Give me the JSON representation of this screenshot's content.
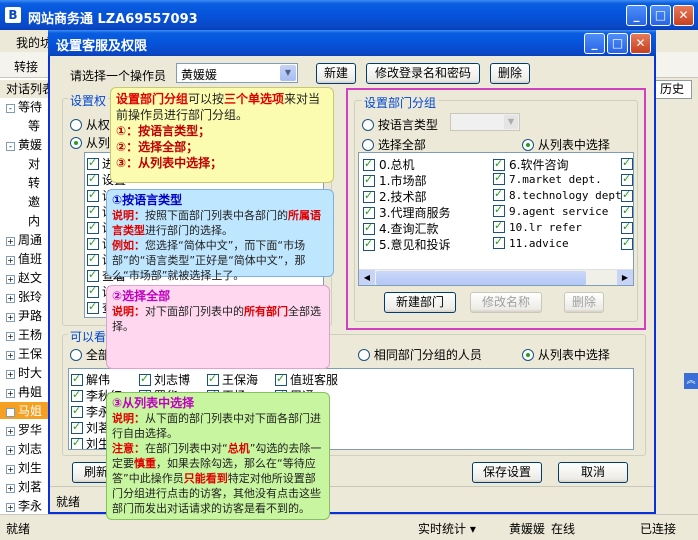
{
  "main_window": {
    "title": "网站商务通 LZA69557093",
    "menu_first": "我的坊",
    "toolbar_first": "转接",
    "left_tab": "对话列表",
    "history_tab": "历史",
    "tree_items": [
      {
        "label": "等待",
        "expanded": "-"
      },
      {
        "label": "等",
        "expanded": ""
      },
      {
        "label": "黄媛",
        "expanded": "-"
      },
      {
        "label": "对",
        "expanded": ""
      },
      {
        "label": "转",
        "expanded": ""
      },
      {
        "label": "邀",
        "expanded": ""
      },
      {
        "label": "内",
        "expanded": ""
      },
      {
        "label": "周通",
        "expanded": "+"
      },
      {
        "label": "值班",
        "expanded": "+"
      },
      {
        "label": "赵文",
        "expanded": "+"
      },
      {
        "label": "张玲",
        "expanded": "+"
      },
      {
        "label": "尹路",
        "expanded": "+"
      },
      {
        "label": "王杨",
        "expanded": "+"
      },
      {
        "label": "王保",
        "expanded": "+"
      },
      {
        "label": "时大",
        "expanded": "+"
      },
      {
        "label": "冉姐",
        "expanded": "+"
      },
      {
        "label": "马姐",
        "expanded": "+"
      },
      {
        "label": "罗华",
        "expanded": "+"
      },
      {
        "label": "刘志",
        "expanded": "+"
      },
      {
        "label": "刘生",
        "expanded": "+"
      },
      {
        "label": "刘茗",
        "expanded": "+"
      },
      {
        "label": "李永",
        "expanded": "+"
      }
    ],
    "status_left": "就绪",
    "status_stats": "实时统计 ▾",
    "status_user": "黄媛媛",
    "status_online": "在线",
    "status_conn": "已连接"
  },
  "dialog": {
    "title": "设置客服及权限",
    "operator_label": "请选择一个操作员",
    "operator_value": "黄媛媛",
    "new_btn": "新建",
    "modify_btn": "修改登录名和密码",
    "delete_btn": "删除",
    "perm_group": "设置权",
    "perm_radio1": "从权",
    "perm_radio2": "从列",
    "perm_items": [
      "进行",
      "设置",
      "设置",
      "设置",
      "设置",
      "设置",
      "设置",
      "查看",
      "设置",
      "查看"
    ],
    "perm_items_right": [
      "",
      "",
      "",
      "",
      "",
      "",
      "",
      "",
      "",
      "",
      "",
      ""
    ],
    "visible_group": "可以看",
    "visible_all": "全部",
    "visible_same": "相同部门分组的人员",
    "visible_list": "从列表中选择",
    "visible_names": [
      [
        "解伟",
        "刘志博",
        "王保海",
        "值班客服"
      ],
      [
        "李秋红",
        "罗华",
        "王杨",
        "周通"
      ],
      [
        "李永",
        "",
        "",
        ""
      ],
      [
        "刘茗",
        "",
        "",
        ""
      ],
      [
        "刘生",
        "",
        "",
        ""
      ]
    ],
    "refresh_btn": "刷新",
    "save_btn": "保存设置",
    "cancel_btn": "取消",
    "status": "就绪",
    "dept": {
      "title": "设置部门分组",
      "radio_lang": "按语言类型",
      "radio_all": "选择全部",
      "radio_list": "从列表中选择",
      "col1": [
        "0.总机",
        "1.市场部",
        "2.技术部",
        "3.代理商服务",
        "4.查询汇款",
        "5.意见和投诉"
      ],
      "col2": [
        "6.软件咨询",
        "7.market dept.",
        "8.technology dept.",
        "9.agent service",
        "10.lr refer",
        "11.advice"
      ],
      "new_btn": "新建部门",
      "rename_btn": "修改名称",
      "delete_btn": "删除"
    }
  },
  "tips": {
    "t1": {
      "a": "设置部门分组",
      "b": "可以按",
      "c": "三个单选项",
      "d": "来对当前操作员进行部门分组。",
      "l1": "①：按语言类型；",
      "l2": "②：选择全部；",
      "l3": "③：从列表中选择；"
    },
    "t2": {
      "h": "①按语言类型",
      "k1": "说明：",
      "p1": "按照下面部门列表中各部门的",
      "r1": "所属语言类型",
      "p2": "进行部门的选择。",
      "k2": "例如：",
      "p3": "您选择“简体中文”，而下面“市场部”的“语言类型”正好是“简体中文”，那么“市场部”就被选择上了。"
    },
    "t3": {
      "h": "②选择全部",
      "k1": "说明：",
      "p1": "对下面部门列表中的",
      "r1": "所有部门",
      "p2": "全部选择。"
    },
    "t4": {
      "h": "③从列表中选择",
      "k1": "说明：",
      "p1": "从下面的部门列表中对下面各部门进行自由选择。",
      "k2": "注意：",
      "p2": "在部门列表中对“",
      "r1": "总机",
      "p3": "”勾选的去除一定要",
      "r2": "慎重",
      "p4": "，如果去除勾选，那么在“等待应答”中此操作员",
      "r3": "只能看到",
      "p5": "特定对他所设置部门分组进行点击的访客，其他没有点击这些部门而发出对话请求的访客是看不到的。"
    }
  }
}
